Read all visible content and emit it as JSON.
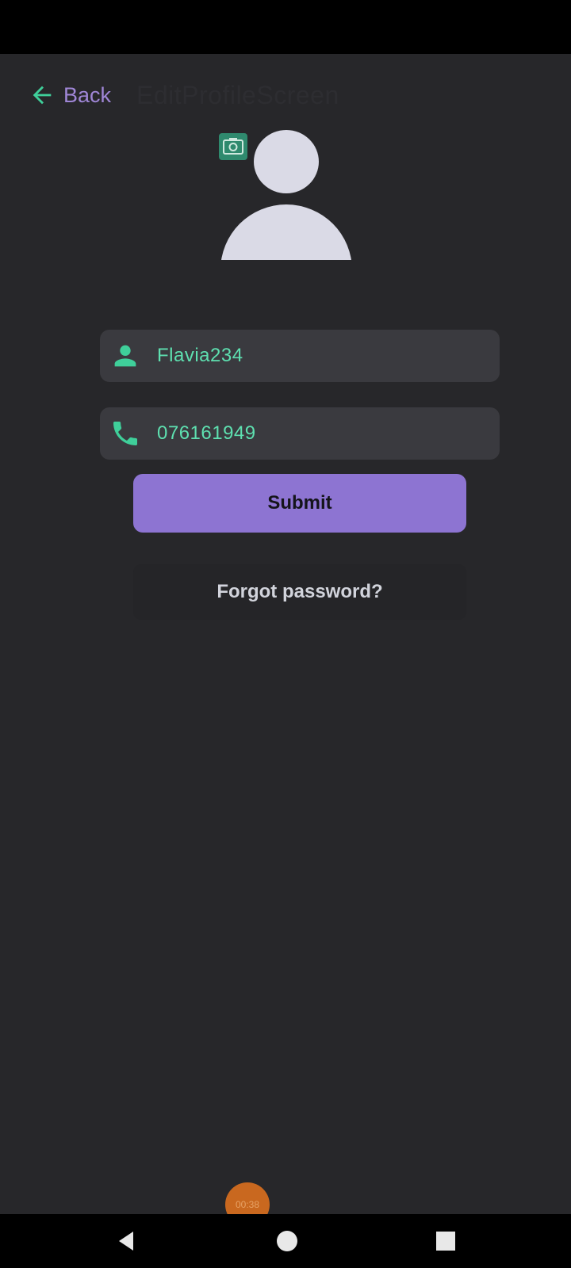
{
  "header": {
    "back_label": "Back",
    "screen_title": "EditProfileScreen"
  },
  "profile": {
    "username": "Flavia234",
    "phone": "076161949"
  },
  "actions": {
    "submit_label": "Submit",
    "forgot_password_label": "Forgot password?"
  },
  "recording": {
    "timer": "00:38"
  },
  "icons": {
    "back": "arrow-left-icon",
    "camera": "camera-icon",
    "user": "person-icon",
    "phone": "phone-icon"
  },
  "colors": {
    "background": "#27272a",
    "accent_green": "#5ee0b0",
    "accent_purple": "#8d74d2",
    "field_background": "#3a3a3f"
  }
}
